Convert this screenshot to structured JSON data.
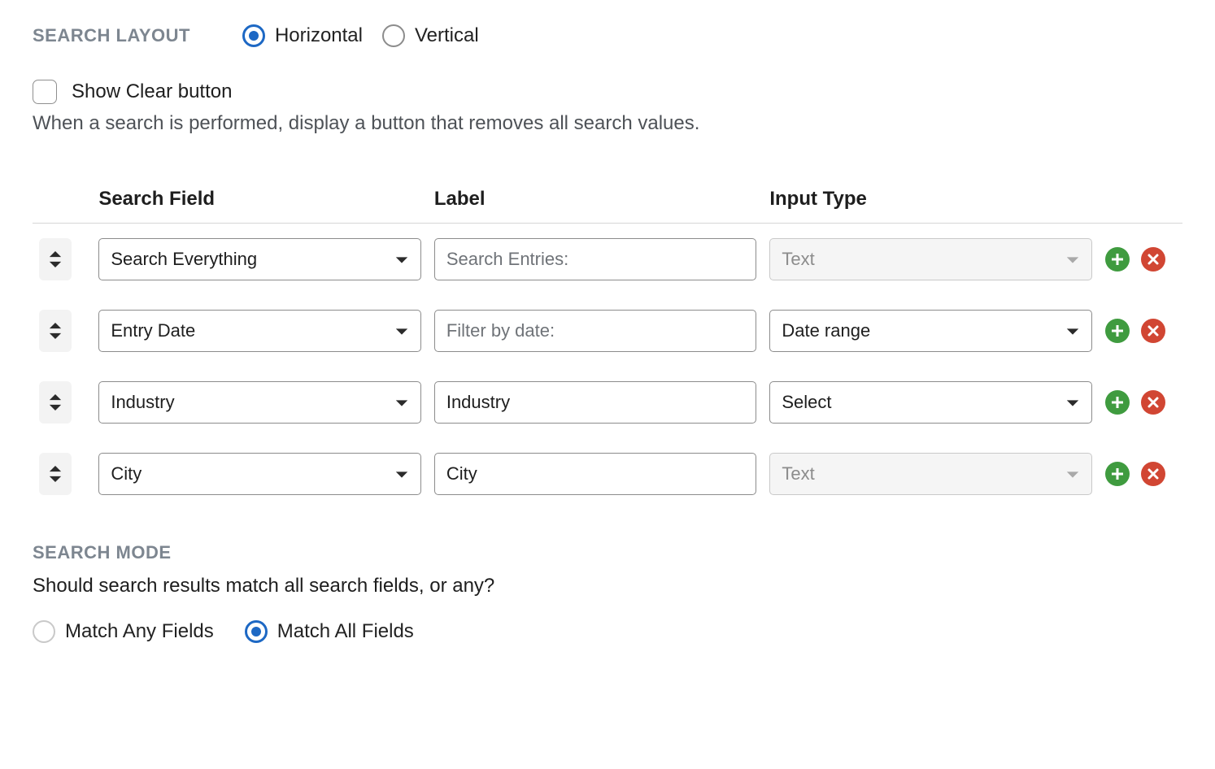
{
  "layout": {
    "heading": "SEARCH LAYOUT",
    "options": {
      "horizontal": "Horizontal",
      "vertical": "Vertical"
    },
    "selected": "horizontal"
  },
  "clear_button": {
    "label": "Show Clear button",
    "help": "When a search is performed, display a button that removes all search values.",
    "checked": false
  },
  "table": {
    "headers": {
      "field": "Search Field",
      "label": "Label",
      "type": "Input Type"
    },
    "rows": [
      {
        "field": "Search Everything",
        "label_placeholder": "Search Entries:",
        "label_value": "",
        "type": "Text",
        "type_disabled": true
      },
      {
        "field": "Entry Date",
        "label_placeholder": "Filter by date:",
        "label_value": "",
        "type": "Date range",
        "type_disabled": false
      },
      {
        "field": "Industry",
        "label_placeholder": "",
        "label_value": "Industry",
        "type": "Select",
        "type_disabled": false
      },
      {
        "field": "City",
        "label_placeholder": "",
        "label_value": "City",
        "type": "Text",
        "type_disabled": true
      }
    ]
  },
  "mode": {
    "heading": "SEARCH MODE",
    "help": "Should search results match all search fields, or any?",
    "options": {
      "any": "Match Any Fields",
      "all": "Match All Fields"
    },
    "selected": "all"
  }
}
